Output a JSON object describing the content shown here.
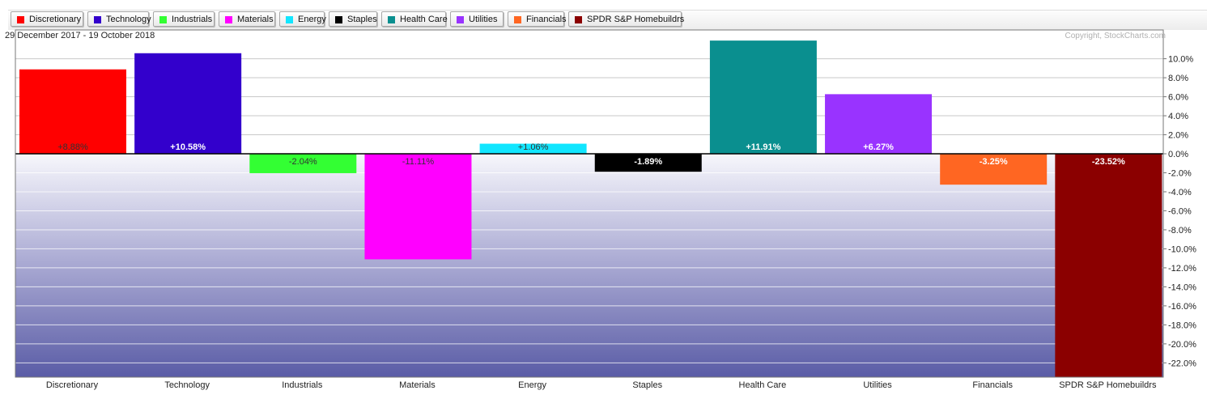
{
  "chart_data": {
    "type": "bar",
    "date_range": "29 December 2017 - 19 October 2018",
    "copyright": "Copyright, StockCharts.com",
    "categories": [
      "Discretionary",
      "Technology",
      "Industrials",
      "Materials",
      "Energy",
      "Staples",
      "Health Care",
      "Utilities",
      "Financials",
      "SPDR S&P Homebuildrs"
    ],
    "values": [
      8.88,
      10.58,
      -2.04,
      -11.11,
      1.06,
      -1.89,
      11.91,
      6.27,
      -3.25,
      -23.52
    ],
    "value_labels": [
      "+8.88%",
      "+10.58%",
      "-2.04%",
      "-11.11%",
      "+1.06%",
      "-1.89%",
      "+11.91%",
      "+6.27%",
      "-3.25%",
      "-23.52%"
    ],
    "colors": [
      "#ff0000",
      "#3300cc",
      "#33ff33",
      "#ff00ff",
      "#11e6ff",
      "#000000",
      "#0a8f8f",
      "#9933ff",
      "#ff6622",
      "#8b0000"
    ],
    "label_colors": [
      "#333333",
      "#ffffff",
      "#333333",
      "#333333",
      "#333333",
      "#ffffff",
      "#ffffff",
      "#ffffff",
      "#ffffff",
      "#ffffff"
    ],
    "y_ticks": [
      10,
      8,
      6,
      4,
      2,
      0,
      -2,
      -4,
      -6,
      -8,
      -10,
      -12,
      -14,
      -16,
      -18,
      -20,
      -22
    ],
    "y_tick_labels": [
      "10.0%",
      "8.0%",
      "6.0%",
      "4.0%",
      "2.0%",
      "0.0%",
      "-2.0%",
      "-4.0%",
      "-6.0%",
      "-8.0%",
      "-10.0%",
      "-12.0%",
      "-14.0%",
      "-16.0%",
      "-18.0%",
      "-20.0%",
      "-22.0%"
    ],
    "ylim": [
      -23.52,
      11.91
    ],
    "y_axis_side": "right",
    "grid": true,
    "legend_placement": "top"
  }
}
